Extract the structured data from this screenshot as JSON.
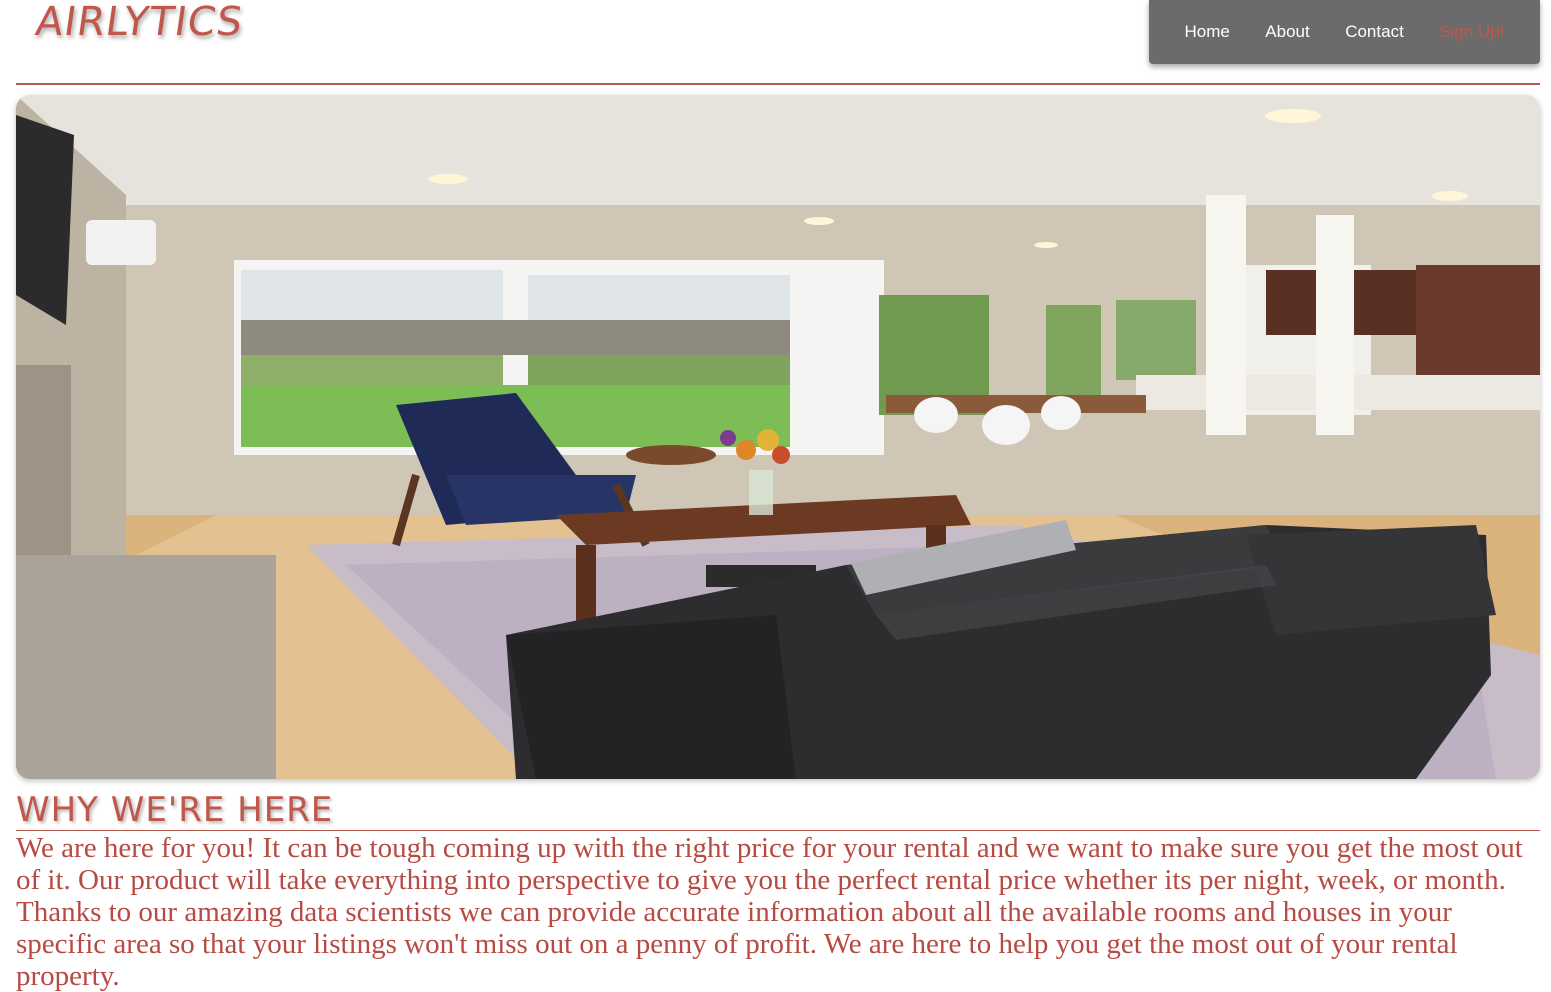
{
  "brand": {
    "logo_text": "AIRLYTICS"
  },
  "nav": {
    "items": [
      {
        "label": "Home"
      },
      {
        "label": "About"
      },
      {
        "label": "Contact"
      },
      {
        "label": "Sign Up!"
      }
    ]
  },
  "hero": {
    "alt": "Living room interior with leather sofa, coffee table and large windows"
  },
  "section": {
    "title": "WHY WE'RE HERE",
    "body": "We are here for you! It can be tough coming up with the right price for your rental and we want to make sure you get the most out of it. Our product will take everything into perspective to give you the perfect rental price whether its per night, week, or month. Thanks to our amazing data scientists we can provide accurate information about all the available rooms and houses in your specific area so that your listings won't miss out on a penny of profit. We are here to help you get the most out of your rental property."
  },
  "colors": {
    "accent": "#c0574b",
    "nav_bg": "#6b6b6b",
    "text": "#b74a42"
  }
}
